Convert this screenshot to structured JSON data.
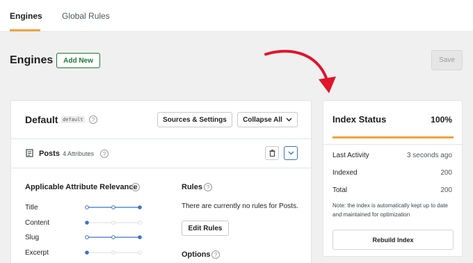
{
  "nav": {
    "tabs": [
      "Engines",
      "Global Rules"
    ]
  },
  "header": {
    "title": "Engines",
    "add_new_label": "Add New",
    "save_label": "Save"
  },
  "engine": {
    "title": "Default",
    "slug": "default",
    "sources_button": "Sources & Settings",
    "collapse_button": "Collapse All",
    "source": {
      "name": "Posts",
      "attribute_count": "4 Attributes"
    },
    "relevance": {
      "heading": "Applicable Attribute Relevance",
      "attributes": [
        {
          "label": "Title",
          "level": 3
        },
        {
          "label": "Content",
          "level": 1
        },
        {
          "label": "Slug",
          "level": 3
        },
        {
          "label": "Excerpt",
          "level": 1
        }
      ]
    },
    "rules": {
      "heading": "Rules",
      "empty_text": "There are currently no rules for Posts.",
      "edit_button": "Edit Rules"
    },
    "options": {
      "heading": "Options"
    }
  },
  "index_status": {
    "title": "Index Status",
    "percent": "100%",
    "progress": 1.0,
    "rows": [
      {
        "label": "Last Activity",
        "value": "3 seconds ago"
      },
      {
        "label": "Indexed",
        "value": "200"
      },
      {
        "label": "Total",
        "value": "200"
      }
    ],
    "note": "Note: the index is automatically kept up to date and maintained for optimization",
    "rebuild_button": "Rebuild Index"
  },
  "colors": {
    "accent": "#f2a33a",
    "primary_green": "#1a7a34",
    "slider_blue": "#3a73c9",
    "arrow_red": "#e0142b"
  }
}
